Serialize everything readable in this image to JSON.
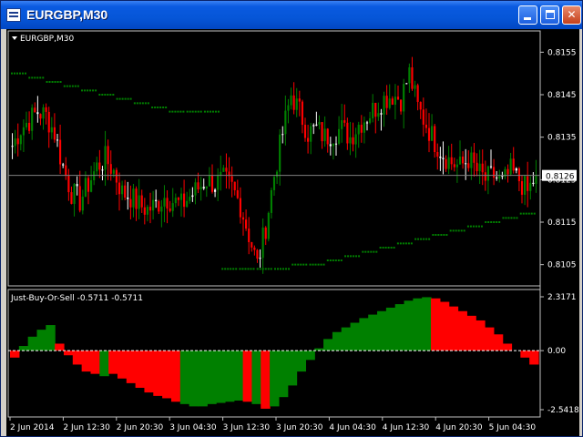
{
  "window": {
    "title": "EURGBP,M30"
  },
  "main_panel": {
    "label": "EURGBP,M30"
  },
  "indicator_panel": {
    "label": "Just-Buy-Or-Sell -0.5711 -0.5711"
  },
  "colors": {
    "bull": "#008000",
    "bear": "#ff0000",
    "background": "#000000",
    "text": "#ffffff",
    "axis": "#c0c0c0"
  },
  "chart_data": [
    {
      "type": "candlestick",
      "symbol": "EURGBP",
      "timeframe": "M30",
      "ylim": [
        0.81,
        0.816
      ],
      "y_ticks": [
        "0.8155",
        "0.8145",
        "0.8135",
        "0.8125",
        "0.8115",
        "0.8105"
      ],
      "current_price": "0.8126",
      "x_ticks": [
        "2 Jun 2014",
        "2 Jun 12:30",
        "2 Jun 20:30",
        "3 Jun 04:30",
        "3 Jun 12:30",
        "3 Jun 20:30",
        "4 Jun 04:30",
        "4 Jun 12:30",
        "4 Jun 20:30",
        "5 Jun 04:30"
      ],
      "close_path": [
        0.8133,
        0.8137,
        0.8139,
        0.8141,
        0.814,
        0.8136,
        0.8128,
        0.8122,
        0.812,
        0.8124,
        0.8128,
        0.813,
        0.8127,
        0.8122,
        0.8121,
        0.8119,
        0.8118,
        0.8119,
        0.8121,
        0.812,
        0.8119,
        0.8121,
        0.8123,
        0.8125,
        0.8124,
        0.8125,
        0.8123,
        0.8119,
        0.8112,
        0.8105,
        0.8114,
        0.8126,
        0.8136,
        0.8145,
        0.8141,
        0.8136,
        0.8137,
        0.8135,
        0.8136,
        0.8137,
        0.8135,
        0.8138,
        0.814,
        0.8142,
        0.8144,
        0.8145,
        0.8144,
        0.815,
        0.8142,
        0.8138,
        0.8134,
        0.8131,
        0.8129,
        0.8128,
        0.813,
        0.8127,
        0.8125,
        0.8126,
        0.8124,
        0.8127,
        0.8125,
        0.8122,
        0.8126
      ],
      "support_levels": [
        0.815,
        0.8149,
        0.8148,
        0.8147,
        0.8146,
        0.8145,
        0.8144,
        0.8143,
        0.8142,
        0.8141,
        0.8141,
        0.8141,
        0.8104,
        0.8104,
        0.8104,
        0.8104,
        0.8105,
        0.8105,
        0.8106,
        0.8107,
        0.8108,
        0.8109,
        0.811,
        0.8111,
        0.8112,
        0.8113,
        0.8114,
        0.8115,
        0.8116,
        0.8117
      ]
    },
    {
      "type": "area",
      "name": "Just-Buy-Or-Sell",
      "ylim": [
        -2.5418,
        2.3171
      ],
      "y_ticks": [
        "2.3171",
        "0.00",
        "-2.5418"
      ],
      "values": [
        -0.3,
        0.2,
        0.6,
        0.9,
        1.1,
        0.3,
        -0.2,
        -0.6,
        -0.9,
        -1.0,
        -1.1,
        -1.0,
        -1.2,
        -1.4,
        -1.6,
        -1.8,
        -1.95,
        -2.05,
        -2.2,
        -2.3,
        -2.4,
        -2.4,
        -2.3,
        -2.25,
        -2.2,
        -2.15,
        -2.2,
        -2.3,
        -2.5,
        -2.4,
        -2.0,
        -1.5,
        -0.9,
        -0.4,
        0.1,
        0.5,
        0.8,
        1.0,
        1.2,
        1.4,
        1.55,
        1.7,
        1.85,
        2.0,
        2.15,
        2.25,
        2.3,
        2.25,
        2.1,
        1.9,
        1.7,
        1.5,
        1.3,
        1.0,
        0.7,
        0.3,
        0.0,
        -0.3,
        -0.6
      ],
      "colors": [
        "bear",
        "bull",
        "bull",
        "bull",
        "bull",
        "bear",
        "bear",
        "bear",
        "bear",
        "bear",
        "bull",
        "bear",
        "bear",
        "bear",
        "bear",
        "bear",
        "bear",
        "bear",
        "bear",
        "bull",
        "bull",
        "bull",
        "bull",
        "bull",
        "bull",
        "bull",
        "bear",
        "bull",
        "bear",
        "bull",
        "bull",
        "bull",
        "bull",
        "bull",
        "bull",
        "bull",
        "bull",
        "bull",
        "bull",
        "bull",
        "bull",
        "bull",
        "bull",
        "bull",
        "bull",
        "bull",
        "bull",
        "bear",
        "bear",
        "bear",
        "bear",
        "bear",
        "bear",
        "bear",
        "bear",
        "bear",
        "bear",
        "bear",
        "bear"
      ],
      "signal_line": "0.00"
    }
  ]
}
